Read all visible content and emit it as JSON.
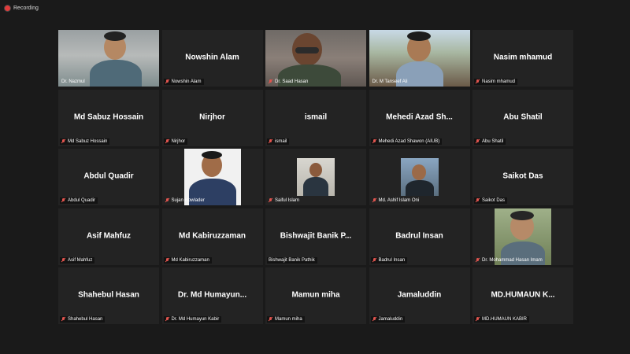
{
  "recording": {
    "label": "Recording"
  },
  "participants": [
    {
      "tile_name": "",
      "label": "Dr. Nazmul",
      "video": "nazmul",
      "muted": false
    },
    {
      "tile_name": "Nowshin Alam",
      "label": "Nowshin Alam",
      "muted": true
    },
    {
      "tile_name": "",
      "label": "Dr. Saad Hasan",
      "video": "saad",
      "muted": true
    },
    {
      "tile_name": "",
      "label": "Dr. M Tanseef Ali",
      "video": "tanseef",
      "muted": false,
      "active_speaker": true
    },
    {
      "tile_name": "Nasim mhamud",
      "label": "Nasim mhamud",
      "muted": true
    },
    {
      "tile_name": "Md Sabuz Hossain",
      "label": "Md Sabuz Hossain",
      "muted": true
    },
    {
      "tile_name": "Nirjhor",
      "label": "Nirjhor",
      "muted": true
    },
    {
      "tile_name": "ismail",
      "label": "ismail",
      "muted": true
    },
    {
      "tile_name": "Mehedi Azad Sh...",
      "label": "Mehedi Azad Shawon (AIUB)",
      "muted": true
    },
    {
      "tile_name": "Abu Shatil",
      "label": "Abu Shatil",
      "muted": true
    },
    {
      "tile_name": "Abdul Quadir",
      "label": "Abdul Quadir",
      "muted": true
    },
    {
      "tile_name": "",
      "label": "Sujan Howlader",
      "photo": "sujan",
      "muted": true
    },
    {
      "tile_name": "",
      "label": "Saiful Islam",
      "photo": "saiful",
      "muted": true
    },
    {
      "tile_name": "",
      "label": "Md. Ashif Islam Oni",
      "photo": "ashif",
      "muted": true
    },
    {
      "tile_name": "Saikot Das",
      "label": "Saikot Das",
      "muted": true
    },
    {
      "tile_name": "Asif Mahfuz",
      "label": "Asif Mahfuz",
      "muted": true
    },
    {
      "tile_name": "Md Kabiruzzaman",
      "label": "Md Kabiruzzaman",
      "muted": true
    },
    {
      "tile_name": "Bishwajit Banik P...",
      "label": "Bishwajit Banik Pathik",
      "muted": false
    },
    {
      "tile_name": "Badrul Insan",
      "label": "Badrul Insan",
      "muted": true
    },
    {
      "tile_name": "",
      "label": "Dr. Mohammad Hasan Imam",
      "photo": "mhimam",
      "muted": true
    },
    {
      "tile_name": "Shahebul Hasan",
      "label": "Shahebul Hasan",
      "muted": true
    },
    {
      "tile_name": "Dr. Md Humayun...",
      "label": "Dr. Md Humayun Kabir",
      "muted": true
    },
    {
      "tile_name": "Mamun miha",
      "label": "Mamun miha",
      "muted": true
    },
    {
      "tile_name": "Jamaluddin",
      "label": "Jamaluddin",
      "muted": true
    },
    {
      "tile_name": "MD.HUMAUN K...",
      "label": "MD.HUMAUN KABIR",
      "muted": true
    }
  ],
  "icons": {
    "recording": "record-dot-icon",
    "mute": "microphone-muted-icon"
  },
  "colors": {
    "background": "#1a1a1a",
    "tile": "#232323",
    "active_border": "#d6e05a",
    "mute": "#e0554f",
    "recording": "#e23b3b"
  }
}
